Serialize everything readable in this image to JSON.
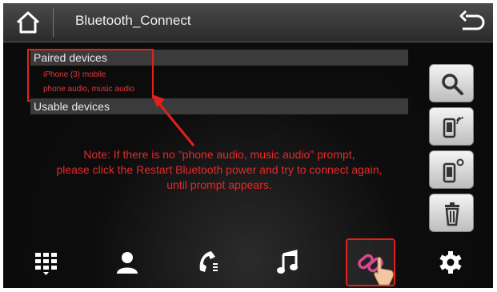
{
  "header": {
    "title": "Bluetooth_Connect",
    "home_icon": "home-icon",
    "back_icon": "back-arrow-icon"
  },
  "paired": {
    "label": "Paired devices",
    "device_name": "iPhone (3) mobile",
    "device_status": "phone audio, music audio"
  },
  "usable": {
    "label": "Usable devices"
  },
  "note": {
    "line1": "Note: If there is no \"phone audio, music audio\" prompt,",
    "line2": "please click the Restart Bluetooth power and try to connect again,",
    "line3": "until prompt appears."
  },
  "side_buttons": [
    "search-icon",
    "phone-bluetooth-icon",
    "phone-settings-icon",
    "trash-icon"
  ],
  "bottom_nav": [
    "dialpad-icon",
    "contacts-icon",
    "call-log-icon",
    "music-note-icon",
    "link-icon",
    "gear-icon"
  ],
  "colors": {
    "accent_red": "#e3211c",
    "note_red": "#e8282a"
  }
}
